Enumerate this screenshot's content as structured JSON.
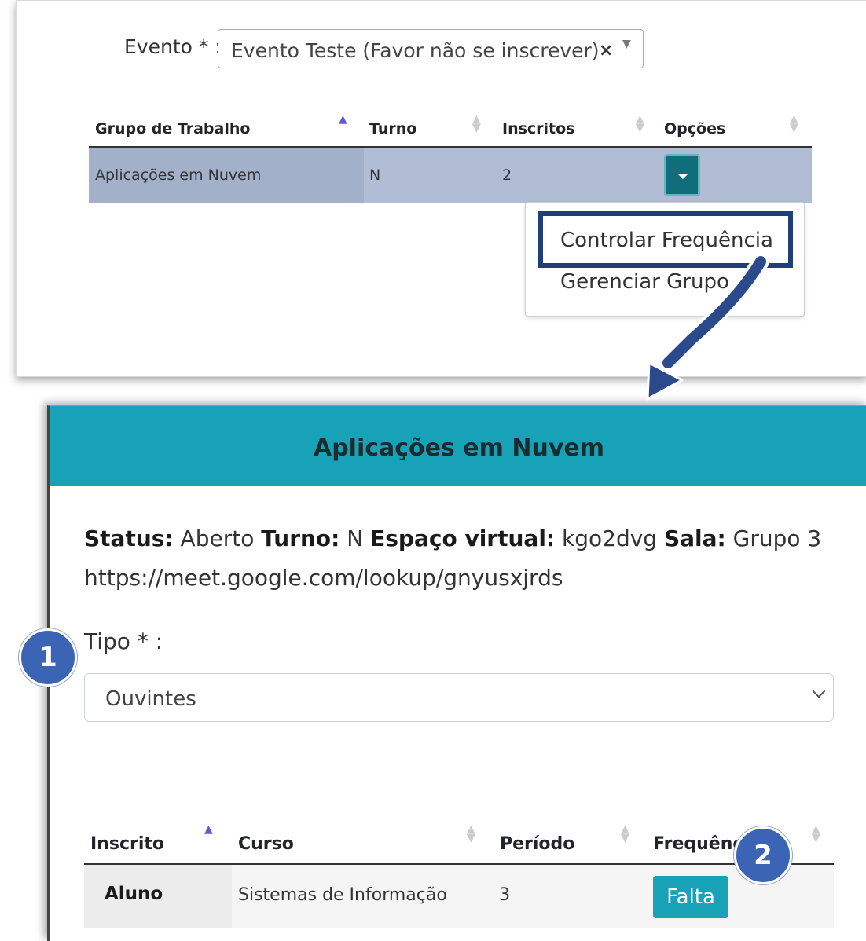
{
  "evento": {
    "label": "Evento * :",
    "selected": "Evento Teste (Favor não se inscrever)",
    "clear_glyph": "×",
    "arrow_glyph": "▼"
  },
  "grupos_table": {
    "headers": [
      "Grupo de Trabalho",
      "Turno",
      "Inscritos",
      "Opções"
    ],
    "sorted_column": "Grupo de Trabalho",
    "row": {
      "grupo": "Aplicações em Nuvem",
      "turno": "N",
      "inscritos": "2"
    },
    "options_icon": "caret-down-icon"
  },
  "options_menu": {
    "items": [
      "Controlar Frequência",
      "Gerenciar Grupo"
    ],
    "highlighted": "Controlar Frequência"
  },
  "modal": {
    "title": "Aplicações em Nuvem",
    "info": {
      "status_label": "Status:",
      "status_value": "Aberto",
      "turno_label": "Turno:",
      "turno_value": "N",
      "espaco_label": "Espaço virtual:",
      "espaco_value": "kgo2dvg",
      "sala_label": "Sala:",
      "sala_value": "Grupo 3",
      "link": "https://meet.google.com/lookup/gnyusxjrds"
    },
    "tipo": {
      "label": "Tipo * :",
      "selected": "Ouvintes"
    },
    "inscritos_table": {
      "headers": [
        "Inscrito",
        "Curso",
        "Período",
        "Frequênc"
      ],
      "sorted_column": "Inscrito",
      "row": {
        "inscrito": "Aluno",
        "curso": "Sistemas de Informação",
        "periodo": "3",
        "frequencia_button": "Falta"
      }
    }
  },
  "badges": [
    "1",
    "2"
  ],
  "colors": {
    "accent_teal": "#18a2b8",
    "row_highlight": "#b1bdd4",
    "menu_highlight_border": "#1f3f7a",
    "badge": "#3c64b4",
    "arrow": "#2a4a8c"
  }
}
